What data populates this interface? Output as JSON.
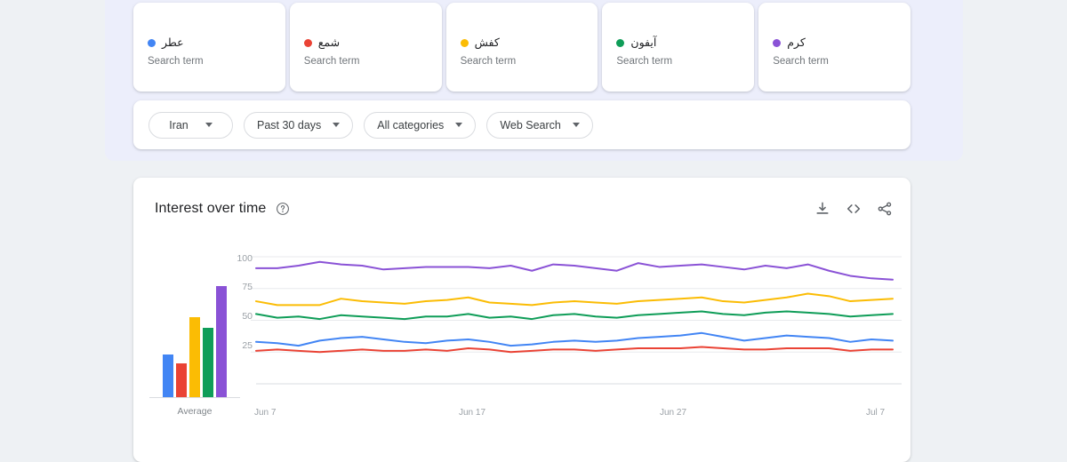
{
  "colors": {
    "blue": "#4285F4",
    "red": "#EA4335",
    "yellow": "#FBBC04",
    "green": "#0F9D58",
    "purple": "#8A52D6",
    "page_bg": "#eef1f4",
    "band_bg": "#eceefb",
    "card_bg": "#ffffff",
    "grid": "#e8eaed",
    "axis_text": "#9aa0a6"
  },
  "terms": [
    {
      "name": "عطر",
      "subtitle": "Search term",
      "color": "#4285F4",
      "dot": "blue-dot"
    },
    {
      "name": "شمع",
      "subtitle": "Search term",
      "color": "#EA4335",
      "dot": "red-dot"
    },
    {
      "name": "کفش",
      "subtitle": "Search term",
      "color": "#FBBC04",
      "dot": "yellow-dot"
    },
    {
      "name": "آیفون",
      "subtitle": "Search term",
      "color": "#0F9D58",
      "dot": "green-dot"
    },
    {
      "name": "کرم",
      "subtitle": "Search term",
      "color": "#8A52D6",
      "dot": "purple-dot"
    }
  ],
  "filters": [
    {
      "label": "Iran",
      "name": "location-filter"
    },
    {
      "label": "Past 30 days",
      "name": "time-range-filter"
    },
    {
      "label": "All categories",
      "name": "category-filter"
    },
    {
      "label": "Web Search",
      "name": "search-type-filter"
    }
  ],
  "interest_over_time": {
    "title": "Interest over time",
    "help_icon": "help-circle-icon",
    "actions": [
      {
        "name": "download-button",
        "icon": "download-icon"
      },
      {
        "name": "embed-button",
        "icon": "code-brackets-icon"
      },
      {
        "name": "share-button",
        "icon": "share-icon"
      }
    ],
    "average_label": "Average"
  },
  "chart_data": {
    "type": "line",
    "title": "Interest over time",
    "xlabel": "",
    "ylabel": "",
    "ylim": [
      0,
      100
    ],
    "yticks": [
      25,
      50,
      75,
      100
    ],
    "grid": true,
    "legend": "cards-above",
    "x_tick_labels": [
      "Jun 7",
      "Jun 17",
      "Jun 27",
      "Jul 7"
    ],
    "x_tick_positions": [
      0,
      10,
      20,
      30
    ],
    "x": [
      "Jun 7",
      "Jun 8",
      "Jun 9",
      "Jun 10",
      "Jun 11",
      "Jun 12",
      "Jun 13",
      "Jun 14",
      "Jun 15",
      "Jun 16",
      "Jun 17",
      "Jun 18",
      "Jun 19",
      "Jun 20",
      "Jun 21",
      "Jun 22",
      "Jun 23",
      "Jun 24",
      "Jun 25",
      "Jun 26",
      "Jun 27",
      "Jun 28",
      "Jun 29",
      "Jun 30",
      "Jul 1",
      "Jul 2",
      "Jul 3",
      "Jul 4",
      "Jul 5",
      "Jul 6",
      "Jul 7"
    ],
    "series": [
      {
        "name": "عطر",
        "color": "#4285F4",
        "average": 34,
        "values": [
          33,
          32,
          30,
          34,
          36,
          37,
          35,
          33,
          32,
          34,
          35,
          33,
          30,
          31,
          33,
          34,
          33,
          34,
          36,
          37,
          38,
          40,
          37,
          34,
          36,
          38,
          37,
          36,
          33,
          35,
          34
        ]
      },
      {
        "name": "شمع",
        "color": "#EA4335",
        "average": 27,
        "values": [
          26,
          27,
          26,
          25,
          26,
          27,
          26,
          26,
          27,
          26,
          28,
          27,
          25,
          26,
          27,
          27,
          26,
          27,
          28,
          28,
          28,
          29,
          28,
          27,
          27,
          28,
          28,
          28,
          26,
          27,
          27
        ]
      },
      {
        "name": "کفش",
        "color": "#FBBC04",
        "average": 64,
        "values": [
          65,
          62,
          62,
          62,
          67,
          65,
          64,
          63,
          65,
          66,
          68,
          64,
          63,
          62,
          64,
          65,
          64,
          63,
          65,
          66,
          67,
          68,
          65,
          64,
          66,
          68,
          71,
          69,
          65,
          66,
          67
        ]
      },
      {
        "name": "آیفون",
        "color": "#0F9D58",
        "average": 56,
        "values": [
          55,
          52,
          53,
          51,
          54,
          53,
          52,
          51,
          53,
          53,
          55,
          52,
          53,
          51,
          54,
          55,
          53,
          52,
          54,
          55,
          56,
          57,
          55,
          54,
          56,
          57,
          56,
          55,
          53,
          54,
          55
        ]
      },
      {
        "name": "کرم",
        "color": "#8A52D6",
        "average": 89,
        "values": [
          91,
          91,
          93,
          96,
          94,
          93,
          90,
          91,
          92,
          92,
          92,
          91,
          93,
          89,
          94,
          93,
          91,
          89,
          95,
          92,
          93,
          94,
          92,
          90,
          93,
          91,
          94,
          89,
          85,
          83,
          82
        ]
      }
    ]
  }
}
